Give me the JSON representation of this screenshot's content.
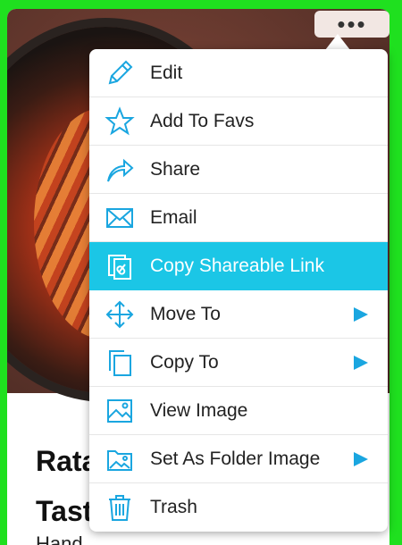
{
  "card": {
    "title_partial": "Rata Tast",
    "title_line1": "Rata",
    "title_line2": "Tast",
    "subtext_partial": "Hand ... ....",
    "menu_button": "•••"
  },
  "menu": {
    "items": [
      {
        "label": "Edit",
        "icon": "pencil-icon",
        "submenu": false
      },
      {
        "label": "Add To Favs",
        "icon": "star-icon",
        "submenu": false
      },
      {
        "label": "Share",
        "icon": "share-arrow-icon",
        "submenu": false
      },
      {
        "label": "Email",
        "icon": "envelope-icon",
        "submenu": false
      },
      {
        "label": "Copy Shareable Link",
        "icon": "copy-link-icon",
        "submenu": false,
        "highlighted": true
      },
      {
        "label": "Move To",
        "icon": "move-arrows-icon",
        "submenu": true
      },
      {
        "label": "Copy To",
        "icon": "copy-pages-icon",
        "submenu": true
      },
      {
        "label": "View Image",
        "icon": "image-icon",
        "submenu": false
      },
      {
        "label": "Set As Folder Image",
        "icon": "folder-image-icon",
        "submenu": true
      },
      {
        "label": "Trash",
        "icon": "trash-icon",
        "submenu": false
      }
    ]
  },
  "colors": {
    "accent": "#1bc6e6",
    "icon_stroke": "#1aa6e0",
    "frame": "#1fe01f"
  }
}
